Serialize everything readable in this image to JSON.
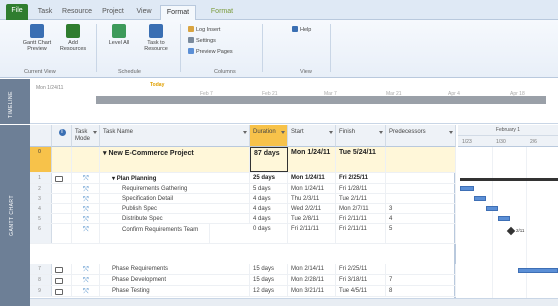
{
  "ribbon": {
    "tabs": [
      {
        "label": "File"
      },
      {
        "label": "Task"
      },
      {
        "label": "Resource"
      },
      {
        "label": "Project"
      },
      {
        "label": "View"
      },
      {
        "label": "Format"
      },
      {
        "label": "Format"
      }
    ],
    "active_tab_index": 5,
    "groups": {
      "current_view": {
        "label": "Current View",
        "buttons": [
          {
            "label": "Gantt Chart Preview",
            "icon": "gantt-chart-icon"
          },
          {
            "label": "Add Resources",
            "icon": "add-resources-icon"
          }
        ]
      },
      "schedule": {
        "label": "Schedule",
        "buttons": [
          {
            "label": "Level All",
            "icon": "level-all-icon"
          },
          {
            "label": "Task to Resource",
            "icon": "task-resource-icon"
          }
        ]
      },
      "columns": {
        "label": "Columns",
        "commands": [
          {
            "label": "Log Insert",
            "icon": "insert-icon"
          },
          {
            "label": "Settings",
            "icon": "settings-icon"
          },
          {
            "label": "Preview Pages",
            "icon": "preview-icon"
          }
        ]
      },
      "view": {
        "label": "View",
        "buttons": [
          {
            "label": "Help",
            "icon": "help-icon"
          }
        ]
      }
    }
  },
  "timeline": {
    "side_label": "TIMELINE",
    "start_label": "Mon 1/24/11",
    "today_label": "Today",
    "ticks": [
      "Feb 7",
      "Feb 21",
      "Mar 7",
      "Mar 21",
      "Apr 4",
      "Apr 18"
    ]
  },
  "grid": {
    "side_label": "GANTT CHART",
    "headers": {
      "info": "",
      "mode": "Task Mode",
      "name": "Task Name",
      "duration": "Duration",
      "start": "Start",
      "finish": "Finish",
      "predecessors": "Predecessors"
    },
    "rows": [
      {
        "num": "0",
        "mode": "",
        "name": "New E-Commerce Project",
        "duration": "87 days",
        "start": "Mon 1/24/11",
        "finish": "Tue 5/24/11",
        "pred": "",
        "level": 0,
        "summary": true,
        "tall": true
      },
      {
        "num": "1",
        "mode": "task-icon",
        "name": "Plan Planning",
        "duration": "25 days",
        "start": "Mon 1/24/11",
        "finish": "Fri 2/25/11",
        "pred": "",
        "level": 1,
        "summary": true
      },
      {
        "num": "2",
        "mode": "task-icon",
        "name": "Requirements Gathering",
        "duration": "5 days",
        "start": "Mon 1/24/11",
        "finish": "Fri 1/28/11",
        "pred": "",
        "level": 2
      },
      {
        "num": "3",
        "mode": "task-icon",
        "name": "Specification Detail",
        "duration": "4 days",
        "start": "Thu 2/3/11",
        "finish": "Tue 2/1/11",
        "pred": "",
        "level": 2
      },
      {
        "num": "4",
        "mode": "task-icon",
        "name": "Publish Spec",
        "duration": "4 days",
        "start": "Wed 2/2/11",
        "finish": "Mon 2/7/11",
        "pred": "3",
        "level": 2
      },
      {
        "num": "5",
        "mode": "task-icon",
        "name": "Distribute Spec",
        "duration": "4 days",
        "start": "Tue 2/8/11",
        "finish": "Fri 2/11/11",
        "pred": "4",
        "level": 2
      },
      {
        "num": "6",
        "mode": "task-icon",
        "name": "Confirm Requirements Team",
        "duration": "0 days",
        "start": "Fri 2/11/11",
        "finish": "Fri 2/11/11",
        "pred": "5",
        "level": 2,
        "tall": true
      },
      {
        "num": "7",
        "mode": "task-icon",
        "name": "Phase Requirements",
        "duration": "15 days",
        "start": "Mon 2/14/11",
        "finish": "Fri 2/25/11",
        "pred": "",
        "level": 1
      },
      {
        "num": "8",
        "mode": "task-icon",
        "name": "Phase Development",
        "duration": "15 days",
        "start": "Mon 2/28/11",
        "finish": "Fri 3/18/11",
        "pred": "7",
        "level": 1
      },
      {
        "num": "9",
        "mode": "task-icon",
        "name": "Phase Testing",
        "duration": "12 days",
        "start": "Mon 3/21/11",
        "finish": "Tue 4/5/11",
        "pred": "8",
        "level": 1
      }
    ]
  },
  "gantt": {
    "top_label": "February 1",
    "day_labels": [
      "1/23",
      "1/30",
      "2/6"
    ],
    "milestone_label": "2/11",
    "colors": {
      "bar": "#5b8fd6",
      "summary": "#333333",
      "highlight": "#f7c24a"
    }
  }
}
